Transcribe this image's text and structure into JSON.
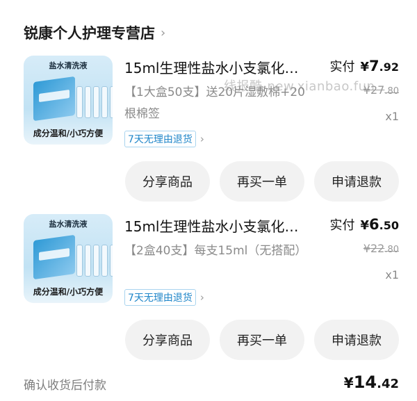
{
  "store": {
    "name": "锐康个人护理专营店",
    "chevron": "›"
  },
  "watermark": "线报酷-new.xianbao.fun",
  "thumbnail": {
    "title": "盐水清洗液",
    "footer": "成分温和/小巧方便"
  },
  "items": [
    {
      "title": "15ml生理性盐水小支氯化…",
      "pay_label": "实付",
      "currency": "¥",
      "pay_int": "7",
      "pay_dec": ".92",
      "orig_int": "¥27",
      "orig_dec": ".80",
      "spec": "【1大盒50支】送20片湿敷棉+20根棉签",
      "qty": "x1",
      "tag": "7天无理由退货",
      "buttons": {
        "share": "分享商品",
        "rebuy": "再买一单",
        "refund": "申请退款"
      }
    },
    {
      "title": "15ml生理性盐水小支氯化…",
      "pay_label": "实付",
      "currency": "¥",
      "pay_int": "6",
      "pay_dec": ".50",
      "orig_int": "¥22",
      "orig_dec": ".80",
      "spec": "【2盒40支】每支15ml（无搭配）",
      "qty": "x1",
      "tag": "7天无理由退货",
      "buttons": {
        "share": "分享商品",
        "rebuy": "再买一单",
        "refund": "申请退款"
      }
    }
  ],
  "footer": {
    "status": "确认收货后付款",
    "currency": "¥",
    "total_int": "14",
    "total_dec": ".42"
  }
}
